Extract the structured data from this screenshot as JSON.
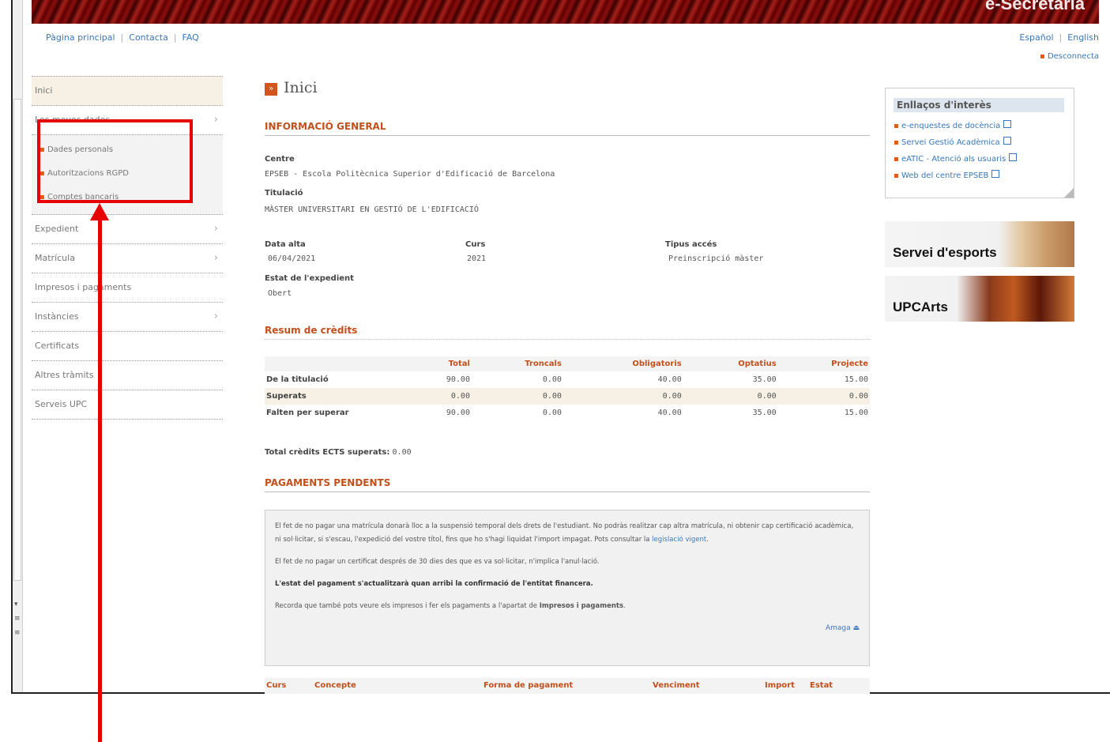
{
  "header": {
    "portal_title": "e-Secretaria",
    "nav": [
      "Pàgina principal",
      "Contacta",
      "FAQ"
    ],
    "languages": [
      "Español",
      "English"
    ],
    "logout": "Desconnecta"
  },
  "sidebar": {
    "items": [
      {
        "label": "Inici",
        "active": true
      },
      {
        "label": "Les meves dades",
        "chevron": true
      },
      {
        "label": "Expedient",
        "chevron": true
      },
      {
        "label": "Matrícula",
        "chevron": true
      },
      {
        "label": "Impresos i pagaments"
      },
      {
        "label": "Instàncies",
        "chevron": true
      },
      {
        "label": "Certificats"
      },
      {
        "label": "Altres tràmits"
      },
      {
        "label": "Serveis UPC"
      }
    ],
    "subitems": [
      "Dades personals",
      "Autoritzacions RGPD",
      "Comptes bancaris"
    ]
  },
  "main": {
    "title": "Inici",
    "general_heading": "INFORMACIÓ GENERAL",
    "centre_label": "Centre",
    "centre_value": "EPSEB - Escola Politècnica Superior d'Edificació de Barcelona",
    "titulacio_label": "Titulació",
    "titulacio_value": "MÀSTER UNIVERSITARI EN GESTIÓ DE L'EDIFICACIÓ",
    "data_alta_label": "Data alta",
    "data_alta_value": "06/04/2021",
    "curs_label": "Curs",
    "curs_value": "2021",
    "tipus_label": "Tipus accés",
    "tipus_value": "Preinscripció màster",
    "estat_label": "Estat de l'expedient",
    "estat_value": "Obert",
    "credits_heading": "Resum de crèdits",
    "credits_table": {
      "headers": [
        "",
        "Total",
        "Troncals",
        "Obligatoris",
        "Optatius",
        "Projecte"
      ],
      "rows": [
        [
          "De la titulació",
          "90.00",
          "0.00",
          "40.00",
          "35.00",
          "15.00"
        ],
        [
          "Superats",
          "0.00",
          "0.00",
          "0.00",
          "0.00",
          "0.00"
        ],
        [
          "Falten per superar",
          "90.00",
          "0.00",
          "40.00",
          "35.00",
          "15.00"
        ]
      ]
    },
    "total_ects_label": "Total crèdits ECTS superats:",
    "total_ects_value": "0.00",
    "payments_heading": "PAGAMENTS PENDENTS",
    "notice": {
      "p1": "El fet de no pagar una matrícula donarà lloc a la suspensió temporal dels drets de l'estudiant. No podràs realitzar cap altra matrícula, ni obtenir cap certificació acadèmica, ni sol·licitar, si s'escau, l'expedició del vostre títol, fins que ho s'hagi liquidat l'import impagat. Pots consultar la",
      "p1_link": "legislació vigent",
      "p2": "El fet de no pagar un certificat després de 30 dies des que es va sol·licitar, n'implica l'anul·lació.",
      "p3": "L'estat del pagament s'actualitzarà quan arribi la confirmació de l'entitat financera.",
      "p4": "Recorda que també pots veure els impresos i fer els pagaments a l'apartat de",
      "p4_bold": "Impresos i pagaments",
      "hide": "Amaga"
    },
    "payments_columns": [
      "Curs",
      "Concepte",
      "Forma de pagament",
      "Venciment",
      "Import",
      "Estat"
    ]
  },
  "right": {
    "links_heading": "Enllaços d'interès",
    "links": [
      "e-enquestes de docència",
      "Servei Gestió Acadèmica",
      "eATIC - Atenció als usuaris",
      "Web del centre EPSEB"
    ],
    "promo1": "Servei d'esports",
    "promo2": "UPCArts"
  },
  "colors": {
    "accent": "#c2501c",
    "link": "#3a77b8",
    "annotation": "#e60000"
  }
}
